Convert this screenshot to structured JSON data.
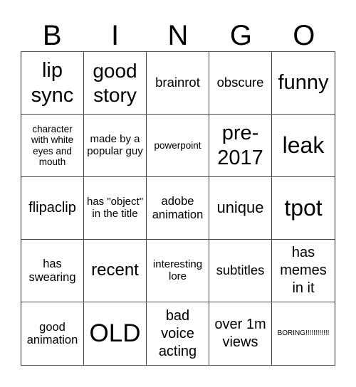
{
  "header": {
    "letters": [
      "B",
      "I",
      "N",
      "G",
      "O"
    ]
  },
  "cells": [
    "lip sync",
    "good story",
    "brainrot",
    "obscure",
    "funny",
    "character with white eyes and mouth",
    "made by a popular guy",
    "powerpoint",
    "pre-2017",
    "leak",
    "flipaclip",
    "has \"object\" in the title",
    "adobe animation",
    "unique",
    "tpot",
    "has swearing",
    "recent",
    "interesting lore",
    "subtitles",
    "has memes in it",
    "good animation",
    "OLD",
    "bad voice acting",
    "over 1m views",
    "BORING!!!!!!!!!!!!"
  ]
}
